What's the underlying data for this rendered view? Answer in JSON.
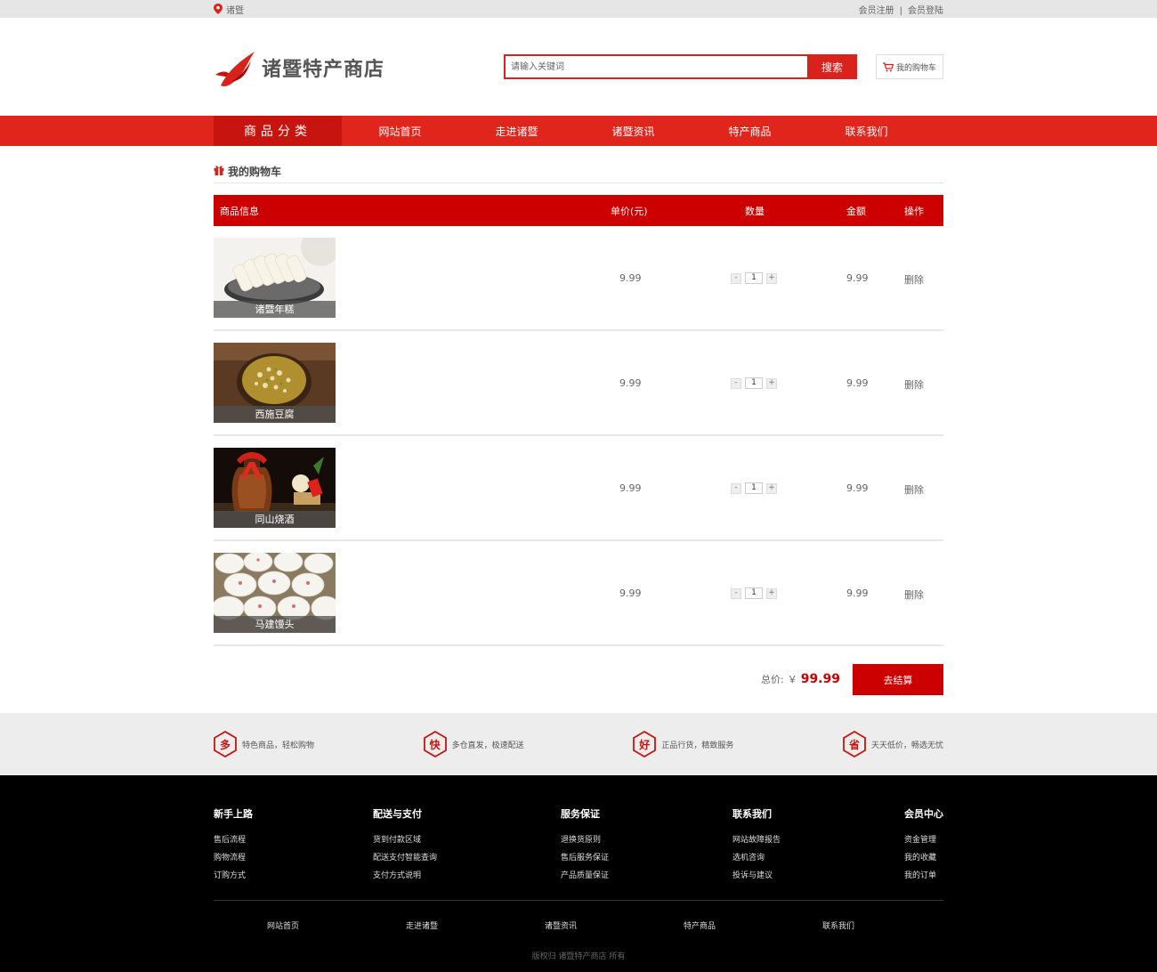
{
  "topbar": {
    "location": "诸暨",
    "register": "会员注册",
    "separator": "|",
    "login": "会员登陆"
  },
  "header": {
    "logo_text": "诸暨特产商店",
    "search_placeholder": "请输入关键词",
    "search_button": "搜索",
    "cart_button": "我的购物车"
  },
  "nav": {
    "category": "商品分类",
    "items": [
      "网站首页",
      "走进诸暨",
      "诸暨资讯",
      "特产商品",
      "联系我们"
    ]
  },
  "cart": {
    "title": "我的购物车",
    "columns": {
      "info": "商品信息",
      "price": "单价(元)",
      "qty": "数量",
      "amount": "金额",
      "action": "操作"
    },
    "rows": [
      {
        "name": "诸暨年糕",
        "price": "9.99",
        "qty": "1",
        "amount": "9.99",
        "action": "删除"
      },
      {
        "name": "西施豆腐",
        "price": "9.99",
        "qty": "1",
        "amount": "9.99",
        "action": "删除"
      },
      {
        "name": "同山烧酒",
        "price": "9.99",
        "qty": "1",
        "amount": "9.99",
        "action": "删除"
      },
      {
        "name": "马建馒头",
        "price": "9.99",
        "qty": "1",
        "amount": "9.99",
        "action": "删除"
      }
    ],
    "minus": "-",
    "plus": "+",
    "total_label": "总价:",
    "currency": "￥",
    "total_value": "99.99",
    "checkout": "去结算"
  },
  "features": [
    {
      "glyph": "多",
      "text": "特色商品，轻松购物"
    },
    {
      "glyph": "快",
      "text": "多仓直发，极速配送"
    },
    {
      "glyph": "好",
      "text": "正品行货，精致服务"
    },
    {
      "glyph": "省",
      "text": "天天低价，畅选无忧"
    }
  ],
  "footer": {
    "columns": [
      {
        "title": "新手上路",
        "links": [
          "售后流程",
          "购物流程",
          "订购方式"
        ]
      },
      {
        "title": "配送与支付",
        "links": [
          "货到付款区域",
          "配送支付智能查询",
          "支付方式说明"
        ]
      },
      {
        "title": "服务保证",
        "links": [
          "退换货原则",
          "售后服务保证",
          "产品质量保证"
        ]
      },
      {
        "title": "联系我们",
        "links": [
          "网站故障报告",
          "选机咨询",
          "投诉与建议"
        ]
      },
      {
        "title": "会员中心",
        "links": [
          "资金管理",
          "我的收藏",
          "我的订单"
        ]
      }
    ],
    "bottom_links": [
      "网站首页",
      "走进诸暨",
      "诸暨资讯",
      "特产商品",
      "联系我们"
    ],
    "copyright": "版权归 诸暨特产商店 所有"
  },
  "colors": {
    "brand_red": "#d9221c",
    "dark_red": "#cc0000",
    "footer_bg": "#000000"
  }
}
